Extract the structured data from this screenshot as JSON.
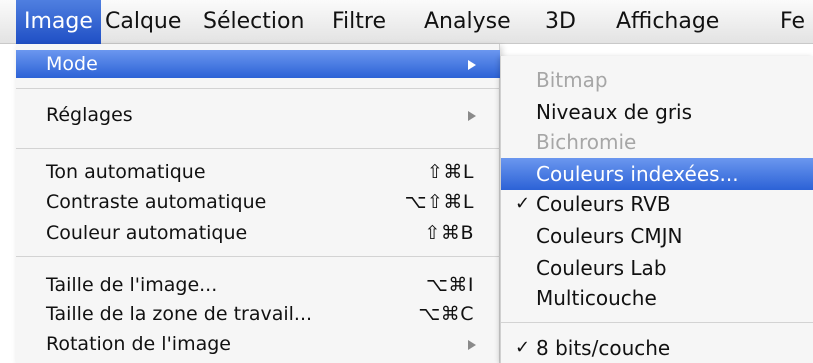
{
  "menubar": {
    "items": [
      "Image",
      "Calque",
      "Sélection",
      "Filtre",
      "Analyse",
      "3D",
      "Affichage",
      "Fe"
    ]
  },
  "image_menu": {
    "items": [
      {
        "label": "Mode",
        "shortcut": "",
        "submenu": true
      },
      {
        "label": "Réglages",
        "shortcut": "",
        "submenu": true
      },
      {
        "label": "Ton automatique",
        "shortcut": "⇧⌘L"
      },
      {
        "label": "Contraste automatique",
        "shortcut": "⌥⇧⌘L"
      },
      {
        "label": "Couleur automatique",
        "shortcut": "⇧⌘B"
      },
      {
        "label": "Taille de l'image...",
        "shortcut": "⌥⌘I"
      },
      {
        "label": "Taille de la zone de travail...",
        "shortcut": "⌥⌘C"
      },
      {
        "label": "Rotation de l'image",
        "shortcut": "",
        "submenu": true
      }
    ]
  },
  "mode_submenu": {
    "items": [
      {
        "label": "Bitmap",
        "check": ""
      },
      {
        "label": "Niveaux de gris",
        "check": ""
      },
      {
        "label": "Bichromie",
        "check": ""
      },
      {
        "label": "Couleurs indexées...",
        "check": ""
      },
      {
        "label": "Couleurs RVB",
        "check": "✓"
      },
      {
        "label": "Couleurs CMJN",
        "check": ""
      },
      {
        "label": "Couleurs Lab",
        "check": ""
      },
      {
        "label": "Multicouche",
        "check": ""
      },
      {
        "label": "8 bits/couche",
        "check": "✓"
      }
    ]
  },
  "colors": {
    "highlight": "#2c62d6",
    "disabled_text": "#a6a6a6",
    "menu_background": "#f6f6f6"
  }
}
